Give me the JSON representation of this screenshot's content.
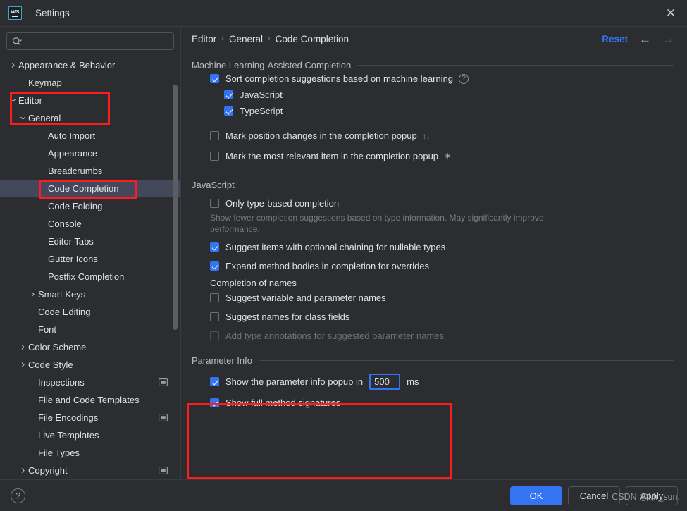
{
  "window": {
    "title": "Settings",
    "app_icon": "webstorm-logo-icon",
    "app_icon_text": "WS",
    "close_icon": "✕"
  },
  "search": {
    "value": "",
    "placeholder": "",
    "icon": "search-icon"
  },
  "sidebar": {
    "items": [
      {
        "label": "Appearance & Behavior",
        "indent": 0,
        "arrow": "collapsed",
        "selected": false,
        "scope_icon": false
      },
      {
        "label": "Keymap",
        "indent": 1,
        "arrow": "none",
        "selected": false,
        "scope_icon": false
      },
      {
        "label": "Editor",
        "indent": 0,
        "arrow": "expanded",
        "selected": false,
        "scope_icon": false
      },
      {
        "label": "General",
        "indent": 1,
        "arrow": "expanded",
        "selected": false,
        "scope_icon": false
      },
      {
        "label": "Auto Import",
        "indent": 3,
        "arrow": "none",
        "selected": false,
        "scope_icon": false
      },
      {
        "label": "Appearance",
        "indent": 3,
        "arrow": "none",
        "selected": false,
        "scope_icon": false
      },
      {
        "label": "Breadcrumbs",
        "indent": 3,
        "arrow": "none",
        "selected": false,
        "scope_icon": false
      },
      {
        "label": "Code Completion",
        "indent": 3,
        "arrow": "none",
        "selected": true,
        "scope_icon": false
      },
      {
        "label": "Code Folding",
        "indent": 3,
        "arrow": "none",
        "selected": false,
        "scope_icon": false
      },
      {
        "label": "Console",
        "indent": 3,
        "arrow": "none",
        "selected": false,
        "scope_icon": false
      },
      {
        "label": "Editor Tabs",
        "indent": 3,
        "arrow": "none",
        "selected": false,
        "scope_icon": false
      },
      {
        "label": "Gutter Icons",
        "indent": 3,
        "arrow": "none",
        "selected": false,
        "scope_icon": false
      },
      {
        "label": "Postfix Completion",
        "indent": 3,
        "arrow": "none",
        "selected": false,
        "scope_icon": false
      },
      {
        "label": "Smart Keys",
        "indent": 2,
        "arrow": "collapsed",
        "selected": false,
        "scope_icon": false
      },
      {
        "label": "Code Editing",
        "indent": 2,
        "arrow": "none",
        "selected": false,
        "scope_icon": false
      },
      {
        "label": "Font",
        "indent": 2,
        "arrow": "none",
        "selected": false,
        "scope_icon": false
      },
      {
        "label": "Color Scheme",
        "indent": 1,
        "arrow": "collapsed",
        "selected": false,
        "scope_icon": false
      },
      {
        "label": "Code Style",
        "indent": 1,
        "arrow": "collapsed",
        "selected": false,
        "scope_icon": false
      },
      {
        "label": "Inspections",
        "indent": 2,
        "arrow": "none",
        "selected": false,
        "scope_icon": true
      },
      {
        "label": "File and Code Templates",
        "indent": 2,
        "arrow": "none",
        "selected": false,
        "scope_icon": false
      },
      {
        "label": "File Encodings",
        "indent": 2,
        "arrow": "none",
        "selected": false,
        "scope_icon": true
      },
      {
        "label": "Live Templates",
        "indent": 2,
        "arrow": "none",
        "selected": false,
        "scope_icon": false
      },
      {
        "label": "File Types",
        "indent": 2,
        "arrow": "none",
        "selected": false,
        "scope_icon": false
      },
      {
        "label": "Copyright",
        "indent": 1,
        "arrow": "collapsed",
        "selected": false,
        "scope_icon": true
      }
    ]
  },
  "breadcrumb": {
    "items": [
      "Editor",
      "General",
      "Code Completion"
    ],
    "separator": "›"
  },
  "toolbar": {
    "reset_label": "Reset",
    "back_icon": "arrow-left-icon",
    "forward_icon": "arrow-right-icon",
    "back_glyph": "←",
    "forward_glyph": "→"
  },
  "sections": {
    "ml": {
      "title": "Machine Learning-Assisted Completion",
      "sort_label": "Sort completion suggestions based on machine learning",
      "sort_checked": true,
      "help_glyph": "?",
      "javascript_label": "JavaScript",
      "javascript_checked": true,
      "typescript_label": "TypeScript",
      "typescript_checked": true,
      "mark_position_label": "Mark position changes in the completion popup",
      "mark_position_checked": false,
      "arrow_up_glyph": "↑",
      "arrow_down_glyph": "↓",
      "mark_relevant_label": "Mark the most relevant item in the completion popup",
      "mark_relevant_checked": false,
      "star_glyph": "✶"
    },
    "javascript": {
      "title": "JavaScript",
      "only_type_based_label": "Only type-based completion",
      "only_type_based_checked": false,
      "only_type_based_hint": "Show fewer completion suggestions based on type information. May significantly improve performance.",
      "optional_chaining_label": "Suggest items with optional chaining for nullable types",
      "optional_chaining_checked": true,
      "expand_method_label": "Expand method bodies in completion for overrides",
      "expand_method_checked": true,
      "completion_of_names_label": "Completion of names",
      "suggest_variable_label": "Suggest variable and parameter names",
      "suggest_variable_checked": false,
      "suggest_class_fields_label": "Suggest names for class fields",
      "suggest_class_fields_checked": false,
      "add_type_annotations_label": "Add type annotations for suggested parameter names",
      "add_type_annotations_checked": false,
      "add_type_annotations_disabled": true
    },
    "parameter_info": {
      "title": "Parameter Info",
      "popup_delay_label": "Show the parameter info popup in",
      "popup_delay_checked": true,
      "popup_delay_value": "500",
      "popup_delay_unit": "ms",
      "full_signatures_label": "Show full method signatures",
      "full_signatures_checked": true
    }
  },
  "footer": {
    "help_glyph": "?",
    "ok_label": "OK",
    "cancel_label": "Cancel",
    "apply_label": "Apply"
  },
  "watermark": {
    "text": "CSDN @Mr_sun."
  },
  "colors": {
    "accent": "#3574f0",
    "annotation": "#fe1c1c",
    "selection": "#43495a",
    "background": "#2b2d30"
  }
}
